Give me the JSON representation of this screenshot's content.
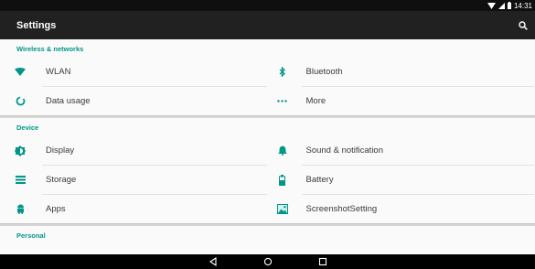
{
  "status": {
    "time": "14:31"
  },
  "appbar": {
    "title": "Settings"
  },
  "sections": {
    "wireless": {
      "header": "Wireless & networks",
      "items": {
        "wlan": "WLAN",
        "bluetooth": "Bluetooth",
        "data_usage": "Data usage",
        "more": "More"
      }
    },
    "device": {
      "header": "Device",
      "items": {
        "display": "Display",
        "sound": "Sound & notification",
        "storage": "Storage",
        "battery": "Battery",
        "apps": "Apps",
        "screenshot": "ScreenshotSetting"
      }
    },
    "personal": {
      "header": "Personal"
    }
  },
  "icons": {
    "wlan": "wifi-icon",
    "bluetooth": "bluetooth-icon",
    "data_usage": "data-usage-icon",
    "more": "more-dots-icon",
    "display": "brightness-icon",
    "sound": "bell-icon",
    "storage": "storage-icon",
    "battery": "battery-icon",
    "apps": "android-icon",
    "screenshot": "image-icon"
  },
  "colors": {
    "accent": "#009688",
    "appbar": "#212121",
    "statusbar": "#0f0f0f",
    "navbar": "#000000"
  }
}
